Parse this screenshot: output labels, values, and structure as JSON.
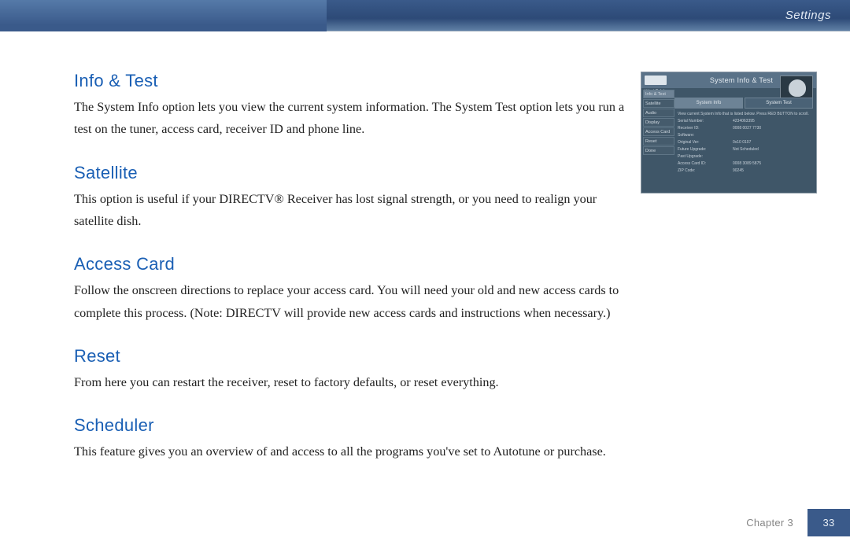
{
  "header": {
    "section_label": "Settings"
  },
  "sections": [
    {
      "heading": "Info & Test",
      "body": "The System Info option lets you view the current system information. The System Test option lets you run a test on the tuner, access card, receiver ID and phone line."
    },
    {
      "heading": "Satellite",
      "body": "This option is useful if your DIRECTV® Receiver has lost signal strength, or you need to realign your satellite dish."
    },
    {
      "heading": "Access Card",
      "body": "Follow the onscreen directions to replace your access card. You will need your old and new access cards to complete this process. (Note: DIRECTV will provide new access cards and instructions when necessary.)"
    },
    {
      "heading": "Reset",
      "body": "From here you can restart the receiver, reset to factory defaults, or reset everything."
    },
    {
      "heading": "Scheduler",
      "body": "This feature gives you an overview of and access to all the programs you've set to Autotune or purchase."
    }
  ],
  "inset": {
    "title": "System Info & Test",
    "date": "Wed 7:14p",
    "tabs": [
      "System Info",
      "System Test"
    ],
    "sidebar": [
      "Info & Test",
      "Satellite",
      "Audio",
      "Display",
      "Access Card",
      "Reset",
      "Done"
    ],
    "hint": "View current System Info that is listed below. Press RED BUTTON to scroll.",
    "rows": [
      {
        "k": "Serial Number:",
        "v": "4234063395"
      },
      {
        "k": "Receiver ID:",
        "v": "0008 0027 7730"
      },
      {
        "k": "Software:",
        "v": ""
      },
      {
        "k": "Original Ver:",
        "v": "0x10 0107"
      },
      {
        "k": "Future Upgrade:",
        "v": "Not Scheduled"
      },
      {
        "k": "Past Upgrade:",
        "v": ""
      },
      {
        "k": "Access Card ID:",
        "v": "0008 3089 5875"
      },
      {
        "k": "ZIP Code:",
        "v": "90245"
      }
    ]
  },
  "footer": {
    "chapter": "Chapter 3",
    "page": "33"
  }
}
